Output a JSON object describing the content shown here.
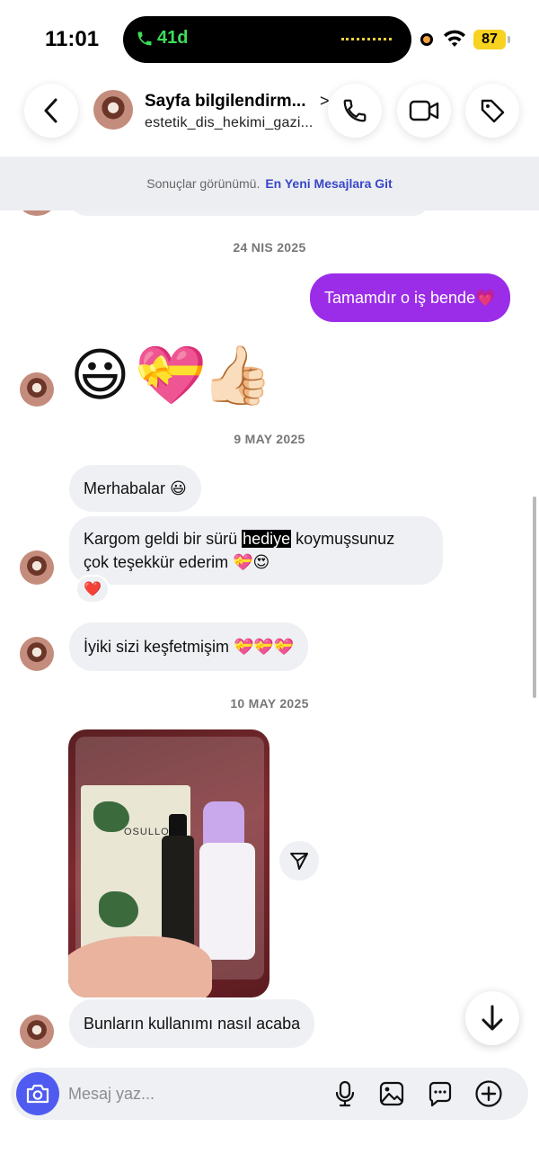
{
  "status_bar": {
    "time": "11:01",
    "call_duration": "41d",
    "battery": "87",
    "accent_call": "#3ddc5a",
    "battery_color": "#f7d21e"
  },
  "header": {
    "title": "Sayfa bilgilendirm...",
    "subtitle": "estetik_dis_hekimi_gazi...",
    "back_icon": "chevron-left-icon",
    "call_icon": "phone-icon",
    "video_icon": "video-camera-icon",
    "tag_icon": "tag-icon"
  },
  "results_banner": {
    "text": "Sonuçlar görünümü.",
    "link": "En Yeni Mesajlara Git",
    "link_color": "#3846c8"
  },
  "messages": {
    "date_1": "24 NIS 2025",
    "outgoing_1": "Tamamdır o iş bende💗",
    "emoji_row": [
      "😃",
      "💝",
      "👍🏻"
    ],
    "date_2": "9 MAY 2025",
    "incoming_1": "Merhabalar 😃",
    "incoming_2_before": "Kargom geldi bir sürü ",
    "incoming_2_highlight": "hediye",
    "incoming_2_after": " koymuşsunuz",
    "incoming_2_line2": "çok teşekkür ederim 💝😍",
    "reaction": "❤️",
    "incoming_3": "İyiki sizi keşfetmişim 💝💝💝",
    "date_3": "10 MAY 2025",
    "photo_brand_text": "OSULLOC",
    "incoming_4": "Bunların kullanımı nasıl acaba",
    "outgoing_color": "#9b2ce8",
    "incoming_color": "#eef0f3"
  },
  "composer": {
    "placeholder": "Mesaj yaz...",
    "camera_color": "#4f5bf0",
    "icons": [
      "microphone-icon",
      "gallery-icon",
      "sticker-chat-icon",
      "plus-circle-icon"
    ]
  }
}
